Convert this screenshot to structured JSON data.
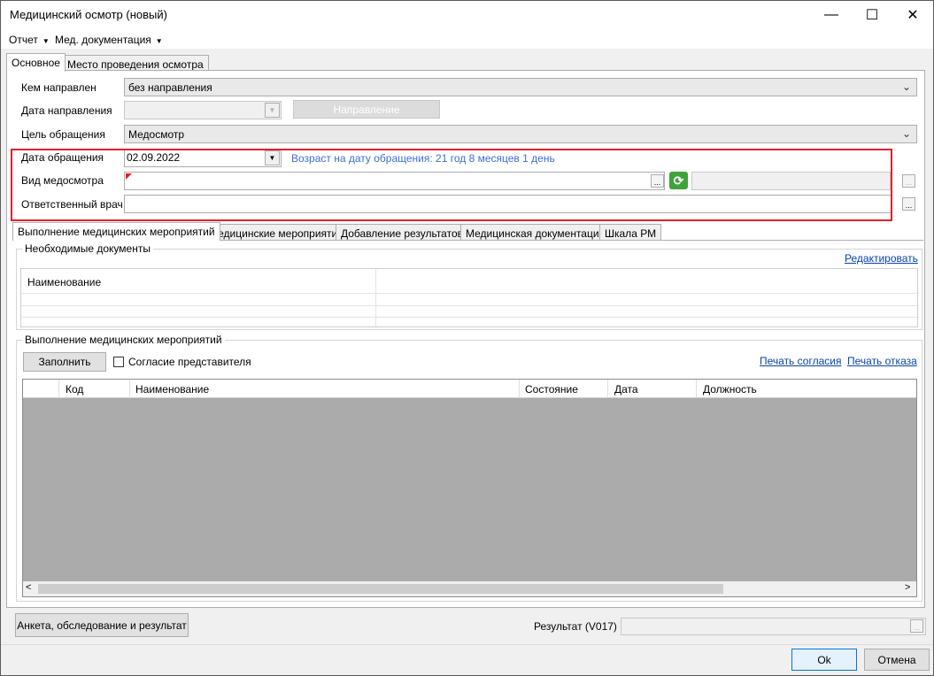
{
  "window": {
    "title": "Медицинский осмотр (новый)",
    "minimize": "—",
    "maximize": "☐",
    "close": "✕"
  },
  "menu": [
    {
      "label": "Отчет"
    },
    {
      "label": "Мед. документация"
    }
  ],
  "main_tabs": [
    {
      "label": "Основное"
    },
    {
      "label": "Место проведения осмотра"
    }
  ],
  "form": {
    "referred_by": {
      "label": "Кем направлен",
      "value": "без направления"
    },
    "referral_date": {
      "label": "Дата направления",
      "value": "",
      "button": "Направление"
    },
    "visit_purpose": {
      "label": "Цель обращения",
      "value": "Медосмотр"
    },
    "visit_date": {
      "label": "Дата обращения",
      "value": "02.09.2022",
      "age_text": "Возраст на дату обращения:  21 год 8 месяцев 1 день"
    },
    "exam_type": {
      "label": "Вид медосмотра",
      "value": "",
      "ellipsis": "..."
    },
    "doctor": {
      "label": "Ответственный врач",
      "value": "",
      "ellipsis": "..."
    }
  },
  "sub_tabs": [
    {
      "label": "Выполнение медицинских мероприятий"
    },
    {
      "label": "Медицинские мероприятия"
    },
    {
      "label": "Добавление результатов"
    },
    {
      "label": "Медицинская документация"
    },
    {
      "label": "Шкала РМ"
    }
  ],
  "docs_group": {
    "title": "Необходимые документы",
    "edit_link": "Редактировать",
    "column": "Наименование"
  },
  "measures_group": {
    "title": "Выполнение медицинских мероприятий",
    "fill_button": "Заполнить",
    "consent_checkbox": "Согласие представителя",
    "print_consent": "Печать согласия",
    "print_refusal": "Печать отказа",
    "columns": [
      "",
      "Код",
      "Наименование",
      "Состояние",
      "Дата",
      "Должность"
    ],
    "scroll_left": "<",
    "scroll_right": ">"
  },
  "footer": {
    "survey_button": "Анкета, обследование и результат",
    "result_label": "Результат (V017)",
    "ok": "Ok",
    "cancel": "Отмена"
  },
  "colors": {
    "highlight": "#e0212c",
    "link": "#0645ad",
    "age_text": "#3b6fd4",
    "grid_empty": "#ababab"
  }
}
